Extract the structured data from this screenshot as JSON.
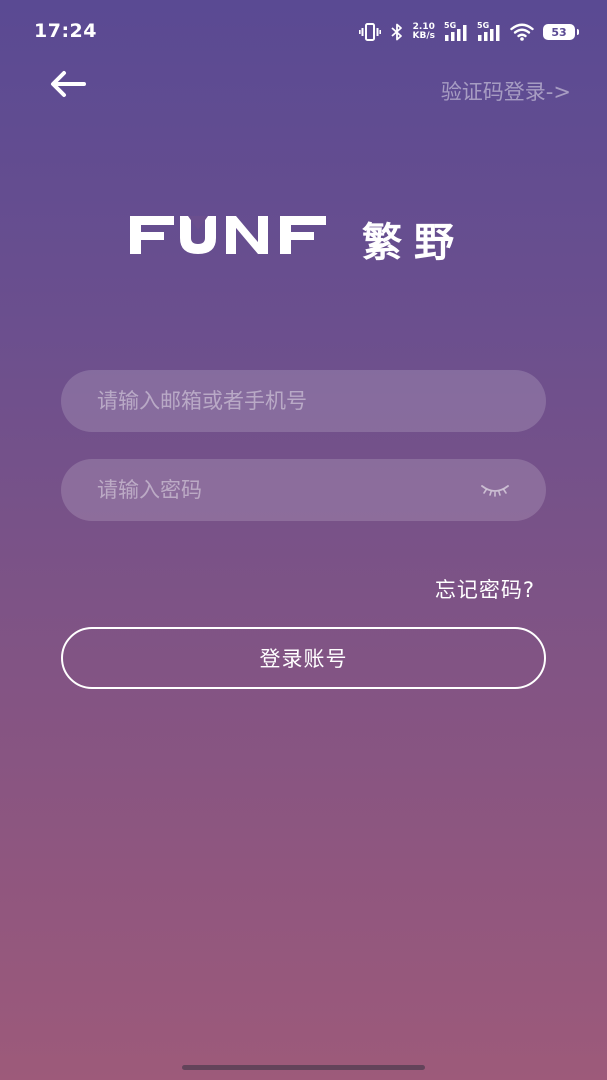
{
  "status_bar": {
    "time": "17:24",
    "net_speed_value": "2.10",
    "net_speed_unit": "KB/s",
    "sim1_label": "5G",
    "sim2_label": "5G",
    "battery_level": "53",
    "icons": [
      "vibrate-icon",
      "bluetooth-icon",
      "signal-icon",
      "signal-icon",
      "wifi-icon",
      "battery-icon"
    ]
  },
  "header": {
    "back_icon": "arrow-left-icon",
    "sms_login_label": "验证码登录->"
  },
  "brand": {
    "logo_name": "FUNF",
    "title": "繁野"
  },
  "form": {
    "account_placeholder": "请输入邮箱或者手机号",
    "account_value": "",
    "password_placeholder": "请输入密码",
    "password_value": "",
    "password_toggle_icon": "eye-closed-icon",
    "forgot_label": "忘记密码?",
    "submit_label": "登录账号"
  },
  "colors": {
    "gradient_top": "#5a4a93",
    "gradient_bottom": "#9d5a7a",
    "text": "#ffffff"
  }
}
